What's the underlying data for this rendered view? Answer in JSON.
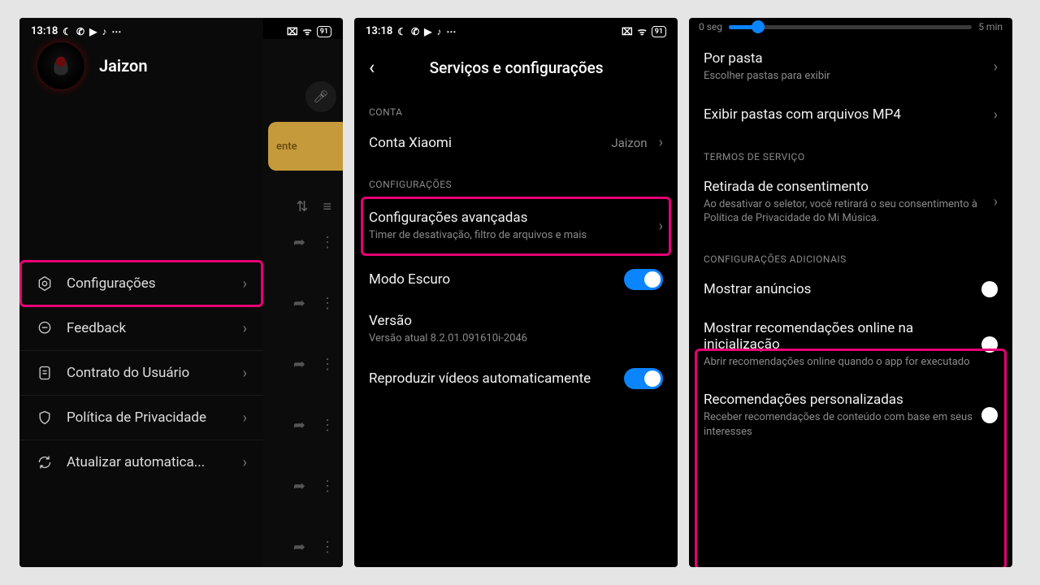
{
  "status": {
    "time": "13:18",
    "battery": "91"
  },
  "screen1": {
    "profile_name": "Jaizon",
    "card_label": "ente",
    "menu": [
      {
        "label": "Configurações"
      },
      {
        "label": "Feedback"
      },
      {
        "label": "Contrato do Usuário"
      },
      {
        "label": "Política de Privacidade"
      },
      {
        "label": "Atualizar automatica..."
      }
    ]
  },
  "screen2": {
    "title": "Serviços e configurações",
    "section_account": "CONTA",
    "account_label": "Conta Xiaomi",
    "account_value": "Jaizon",
    "section_settings": "CONFIGURAÇÕES",
    "adv": {
      "title": "Configurações avançadas",
      "sub": "Timer de desativação, filtro de arquivos e mais"
    },
    "dark": "Modo Escuro",
    "version": {
      "title": "Versão",
      "sub": "Versão atual 8.2.01.091610i-2046"
    },
    "autoplay": "Reproduzir vídeos automaticamente"
  },
  "screen3": {
    "slider_left": "0 seg",
    "slider_right": "5 min",
    "folder": {
      "title": "Por pasta",
      "sub": "Escolher pastas para exibir"
    },
    "mp4": "Exibir pastas com arquivos MP4",
    "section_terms": "TERMOS DE SERVIÇO",
    "consent": {
      "title": "Retirada de consentimento",
      "sub": "Ao desativar o seletor, você retirará o seu consentimento à Política de Privacidade do Mi Música."
    },
    "section_add": "CONFIGURAÇÕES ADICIONAIS",
    "ads": "Mostrar anúncios",
    "rec_start": {
      "title": "Mostrar recomendações online na inicialização",
      "sub": "Abrir recomendações online quando o app for executado"
    },
    "rec_pers": {
      "title": "Recomendações personalizadas",
      "sub": "Receber recomendações de conteúdo com base em seus interesses"
    }
  }
}
